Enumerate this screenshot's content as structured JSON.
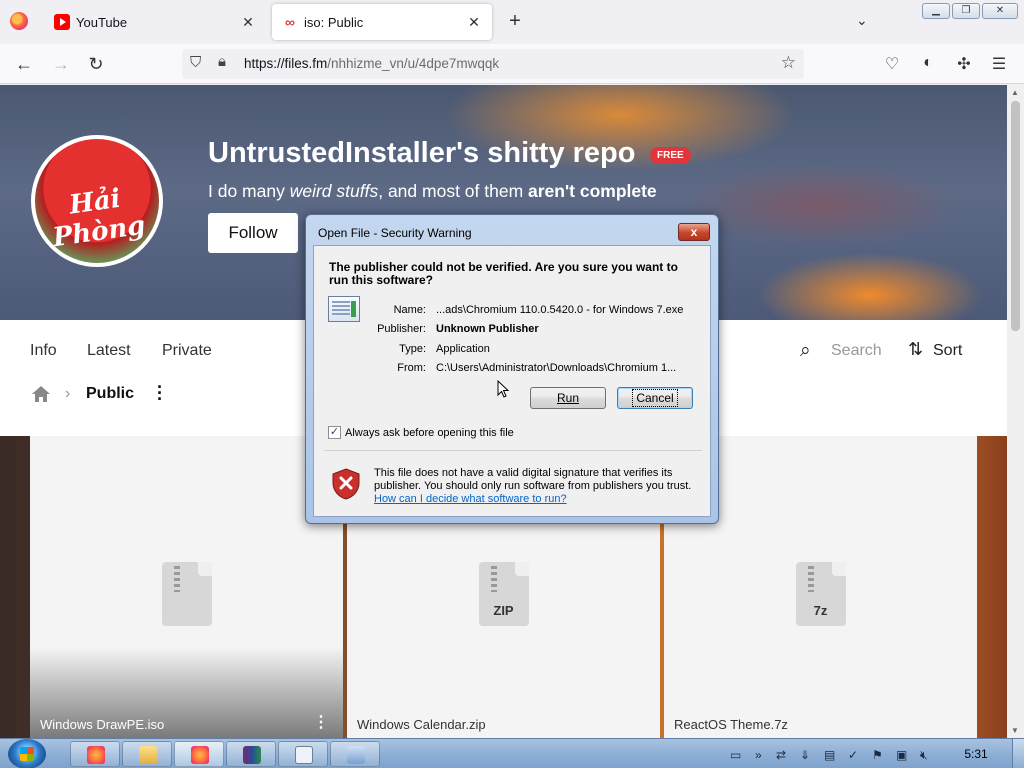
{
  "browser": {
    "tabs": [
      {
        "label": "YouTube",
        "favicon": "youtube-icon",
        "active": false
      },
      {
        "label": "iso: Public",
        "favicon": "filesfm-icon",
        "active": true
      }
    ],
    "url_host": "https://files.fm",
    "url_path": "/nhhizme_vn/u/4dpe7mwqqk"
  },
  "profile": {
    "title": "UntrustedInstaller's shitty repo",
    "badge": "FREE",
    "tagline_1": "I do many ",
    "tagline_em": "weird stuffs",
    "tagline_2": ", and most of them ",
    "tagline_b": "aren't complete",
    "follow_label": "Follow",
    "avatar_text": "Hải Phòng"
  },
  "nav": {
    "tabs": [
      "Info",
      "Latest",
      "Private"
    ],
    "search_label": "Search",
    "sort_label": "Sort",
    "breadcrumb": "Public"
  },
  "files": [
    {
      "name": "Windows DrawPE.iso",
      "type": ""
    },
    {
      "name": "Windows Calendar.zip",
      "type": "ZIP"
    },
    {
      "name": "ReactOS Theme.7z",
      "type": "7z"
    }
  ],
  "dialog": {
    "title": "Open File - Security Warning",
    "close": "x",
    "question": "The publisher could not be verified.  Are you sure you want to run this software?",
    "fields": [
      {
        "key": "Name:",
        "value": "...ads\\Chromium 110.0.5420.0 - for Windows 7.exe",
        "bold": false
      },
      {
        "key": "Publisher:",
        "value": "Unknown Publisher",
        "bold": true
      },
      {
        "key": "Type:",
        "value": "Application",
        "bold": false
      },
      {
        "key": "From:",
        "value": "C:\\Users\\Administrator\\Downloads\\Chromium 1...",
        "bold": false
      }
    ],
    "run_label": "Run",
    "cancel_label": "Cancel",
    "checkbox_label": "Always ask before opening this file",
    "checkbox_checked": true,
    "warning": "This file does not have a valid digital signature that verifies its publisher.  You should only run software from publishers you trust.",
    "link": "How can I decide what software to run?"
  },
  "taskbar": {
    "clock": "5:31"
  },
  "colors": {
    "badge": "#e0363b",
    "link": "#0066cc",
    "taskbar": "#8fb0d6"
  }
}
